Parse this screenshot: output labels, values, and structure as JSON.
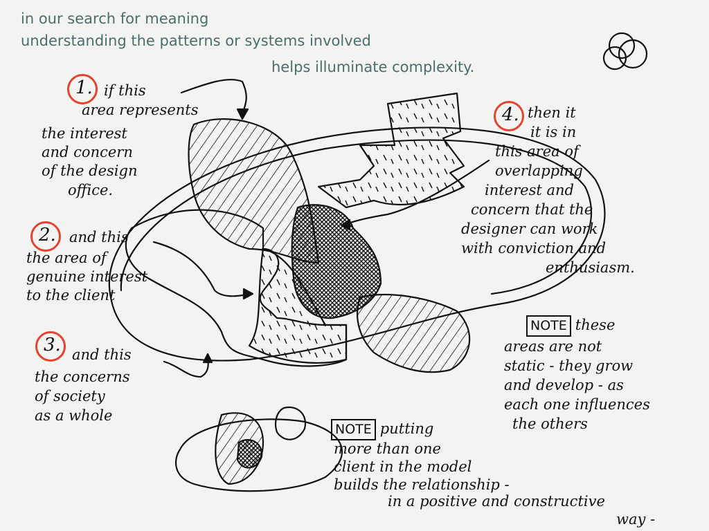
{
  "header": {
    "line1": "in our search for meaning",
    "line2": "understanding the patterns or systems involved",
    "line3": "helps illuminate complexity."
  },
  "colors": {
    "header_text": "#4a6e6c",
    "marker_circle": "#e4432d",
    "ink": "#111111",
    "paper": "#f3f3f1"
  },
  "annotations": [
    {
      "number": "1.",
      "lines": [
        "if this",
        "area represents",
        "the interest",
        "and concern",
        "of the design",
        "office."
      ]
    },
    {
      "number": "2.",
      "lines": [
        "and this",
        "the area of",
        "genuine interest",
        "to the client"
      ]
    },
    {
      "number": "3.",
      "lines": [
        "and this",
        "the concerns",
        "of society",
        "as a whole"
      ]
    },
    {
      "number": "4.",
      "lines": [
        "then it",
        "it is in",
        "this area of",
        "overlapping",
        "interest and",
        "concern that the",
        "designer can work",
        "with conviction and",
        "enthusiasm."
      ]
    }
  ],
  "notes": [
    {
      "label": "NOTE",
      "first": "these",
      "lines": [
        "areas are not",
        "static - they grow",
        "and develop - as",
        "each one influences",
        "the others"
      ]
    },
    {
      "label": "NOTE",
      "first": "putting",
      "lines": [
        "more than one",
        "client in the model",
        "builds the relationship -",
        "in a positive and constructive",
        "way -"
      ]
    }
  ]
}
